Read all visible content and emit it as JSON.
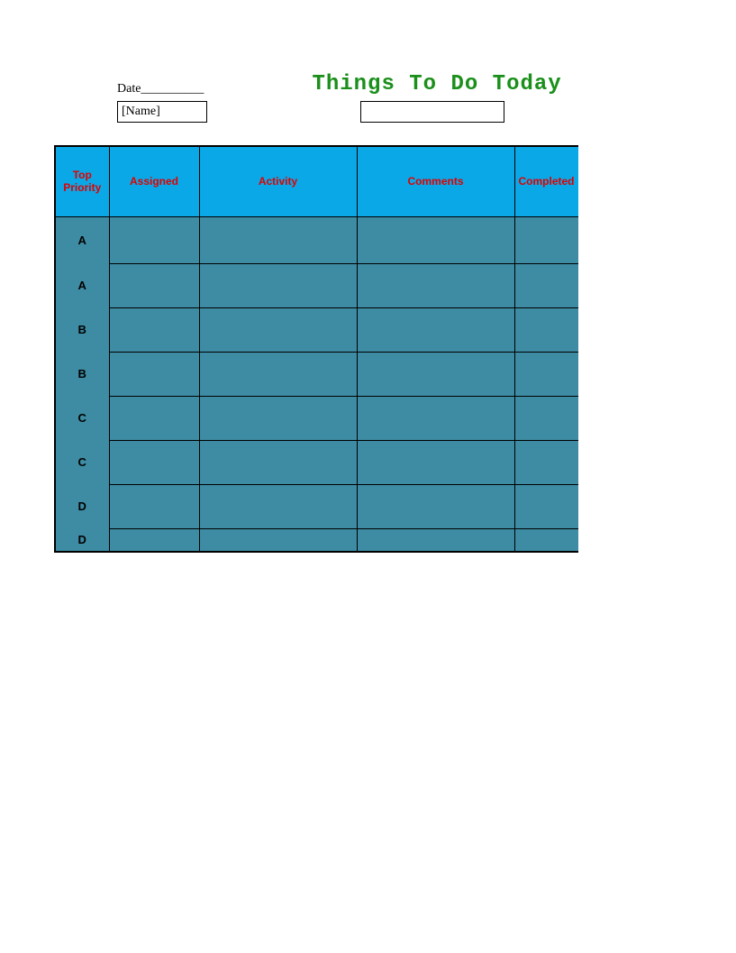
{
  "header": {
    "date_label": "Date__________",
    "title": "Things To Do Today",
    "name_placeholder": "[Name]"
  },
  "table": {
    "columns": [
      "Top Priority",
      "Assigned",
      "Activity",
      "Comments",
      "Completed"
    ],
    "rows": [
      {
        "priority": "A",
        "assigned": "",
        "activity": "",
        "comments": "",
        "completed": ""
      },
      {
        "priority": "A",
        "assigned": "",
        "activity": "",
        "comments": "",
        "completed": ""
      },
      {
        "priority": "B",
        "assigned": "",
        "activity": "",
        "comments": "",
        "completed": ""
      },
      {
        "priority": "B",
        "assigned": "",
        "activity": "",
        "comments": "",
        "completed": ""
      },
      {
        "priority": "C",
        "assigned": "",
        "activity": "",
        "comments": "",
        "completed": ""
      },
      {
        "priority": "C",
        "assigned": "",
        "activity": "",
        "comments": "",
        "completed": ""
      },
      {
        "priority": "D",
        "assigned": "",
        "activity": "",
        "comments": "",
        "completed": ""
      },
      {
        "priority": "D",
        "assigned": "",
        "activity": "",
        "comments": "",
        "completed": ""
      }
    ]
  }
}
